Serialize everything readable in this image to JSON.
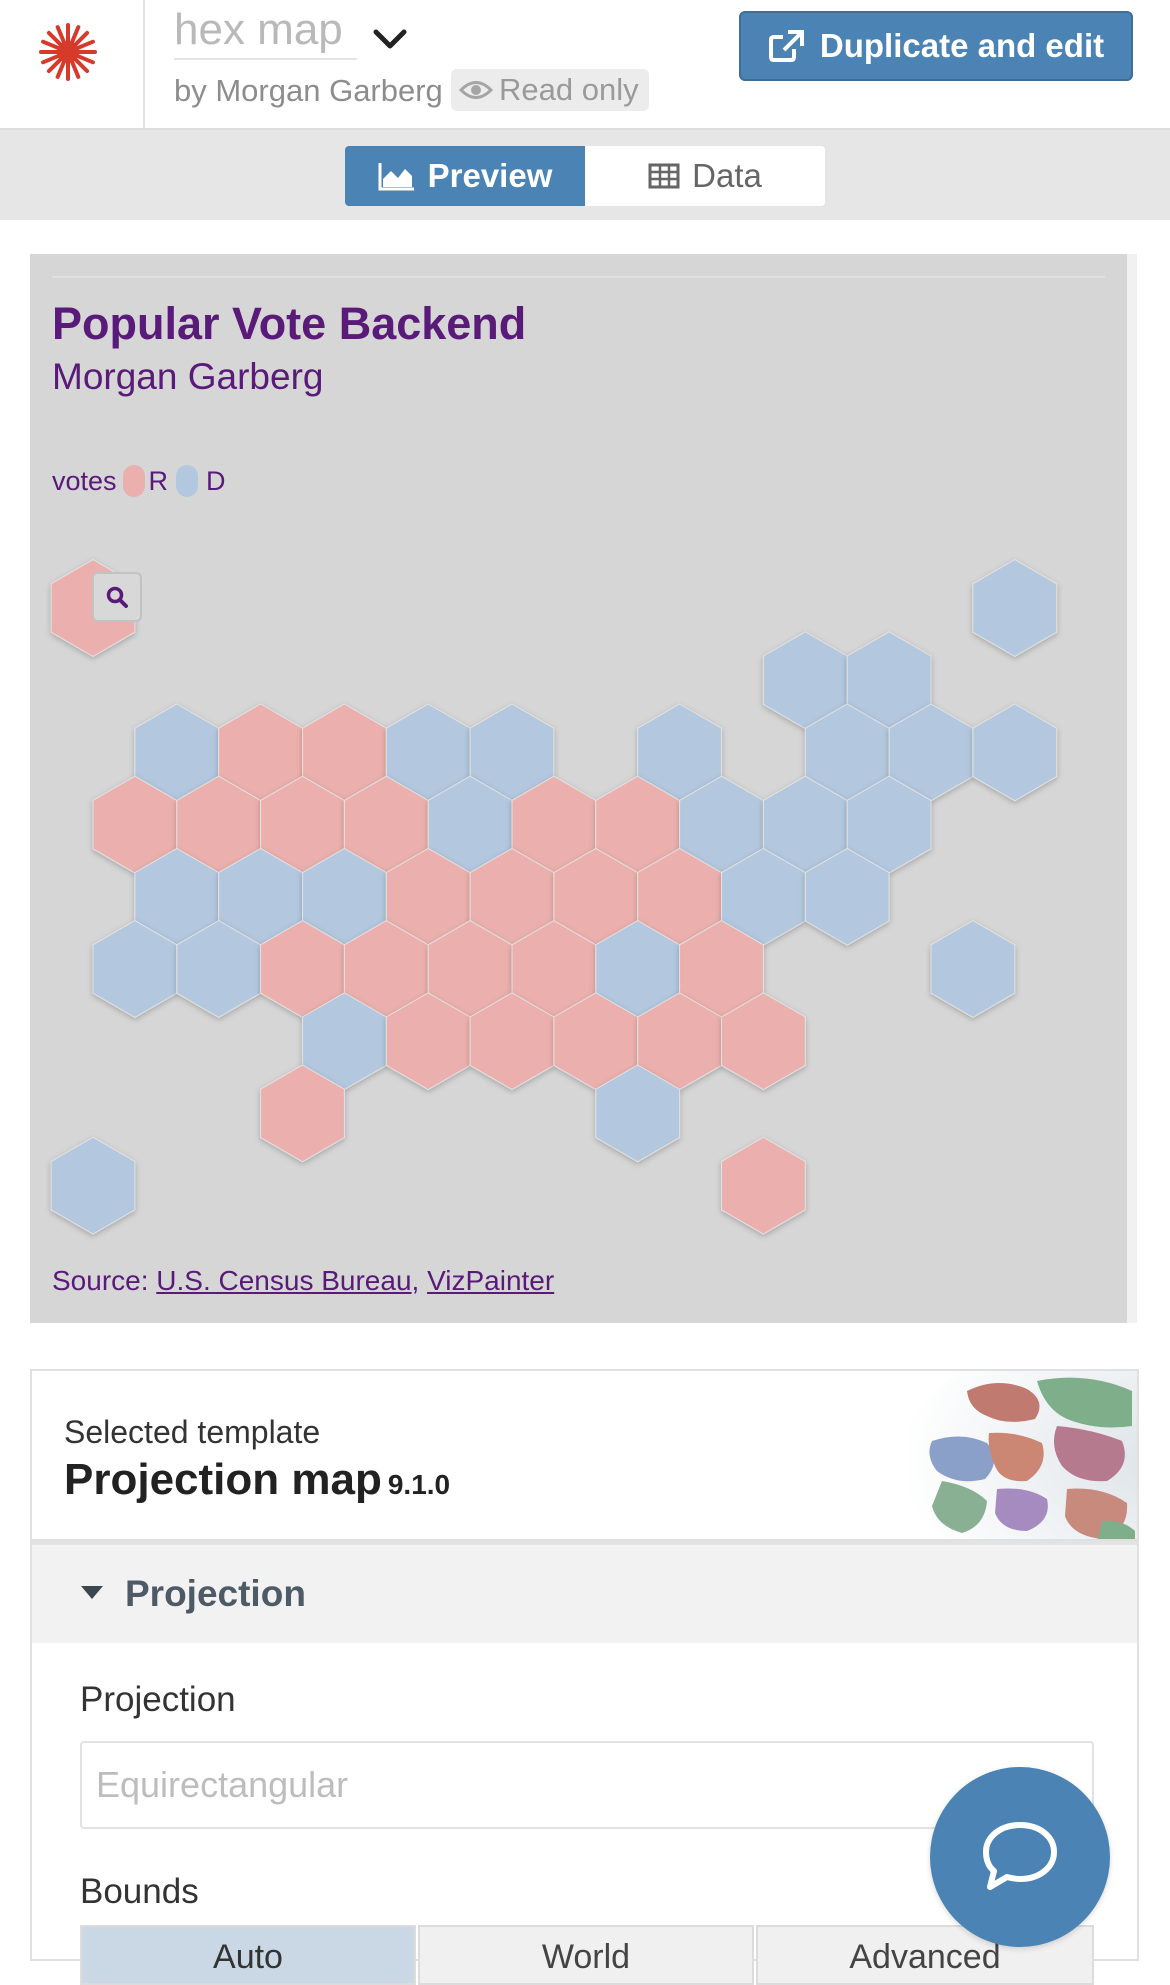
{
  "header": {
    "viz_name": "hex map",
    "byline": "by Morgan Garberg",
    "read_only_label": "Read only",
    "duplicate_label": "Duplicate and edit"
  },
  "tabs": [
    {
      "label": "Preview",
      "active": true
    },
    {
      "label": "Data",
      "active": false
    }
  ],
  "visualization": {
    "title": "Popular Vote Backend",
    "subtitle": "Morgan Garberg",
    "legend": {
      "title": "votes",
      "items": [
        {
          "label": "R",
          "color": "#ebb0ad"
        },
        {
          "label": "D",
          "color": "#b3c7de"
        }
      ]
    },
    "source_prefix": "Source:",
    "source_links": [
      "U.S. Census Bureau",
      "VizPainter"
    ],
    "source_separator": ","
  },
  "hex_states": [
    {
      "row": 0,
      "col": 0,
      "party": "R"
    },
    {
      "row": 0,
      "col": 11,
      "party": "D"
    },
    {
      "row": 1,
      "col": 9,
      "party": "D"
    },
    {
      "row": 1,
      "col": 10,
      "party": "D"
    },
    {
      "row": 2,
      "col": 1,
      "party": "D"
    },
    {
      "row": 2,
      "col": 2,
      "party": "R"
    },
    {
      "row": 2,
      "col": 3,
      "party": "R"
    },
    {
      "row": 2,
      "col": 4,
      "party": "D"
    },
    {
      "row": 2,
      "col": 5,
      "party": "D"
    },
    {
      "row": 2,
      "col": 7,
      "party": "D"
    },
    {
      "row": 2,
      "col": 9,
      "party": "D"
    },
    {
      "row": 2,
      "col": 10,
      "party": "D"
    },
    {
      "row": 2,
      "col": 11,
      "party": "D"
    },
    {
      "row": 3,
      "col": 1,
      "party": "R"
    },
    {
      "row": 3,
      "col": 2,
      "party": "R"
    },
    {
      "row": 3,
      "col": 3,
      "party": "R"
    },
    {
      "row": 3,
      "col": 4,
      "party": "R"
    },
    {
      "row": 3,
      "col": 5,
      "party": "D"
    },
    {
      "row": 3,
      "col": 6,
      "party": "R"
    },
    {
      "row": 3,
      "col": 7,
      "party": "R"
    },
    {
      "row": 3,
      "col": 8,
      "party": "D"
    },
    {
      "row": 3,
      "col": 9,
      "party": "D"
    },
    {
      "row": 3,
      "col": 10,
      "party": "D"
    },
    {
      "row": 4,
      "col": 1,
      "party": "D"
    },
    {
      "row": 4,
      "col": 2,
      "party": "D"
    },
    {
      "row": 4,
      "col": 3,
      "party": "D"
    },
    {
      "row": 4,
      "col": 4,
      "party": "R"
    },
    {
      "row": 4,
      "col": 5,
      "party": "R"
    },
    {
      "row": 4,
      "col": 6,
      "party": "R"
    },
    {
      "row": 4,
      "col": 7,
      "party": "R"
    },
    {
      "row": 4,
      "col": 8,
      "party": "D"
    },
    {
      "row": 4,
      "col": 9,
      "party": "D"
    },
    {
      "row": 5,
      "col": 1,
      "party": "D"
    },
    {
      "row": 5,
      "col": 2,
      "party": "D"
    },
    {
      "row": 5,
      "col": 3,
      "party": "R"
    },
    {
      "row": 5,
      "col": 4,
      "party": "R"
    },
    {
      "row": 5,
      "col": 5,
      "party": "R"
    },
    {
      "row": 5,
      "col": 6,
      "party": "R"
    },
    {
      "row": 5,
      "col": 7,
      "party": "D"
    },
    {
      "row": 5,
      "col": 8,
      "party": "R"
    },
    {
      "row": 5,
      "col": 11,
      "party": "D"
    },
    {
      "row": 6,
      "col": 3,
      "party": "D"
    },
    {
      "row": 6,
      "col": 4,
      "party": "R"
    },
    {
      "row": 6,
      "col": 5,
      "party": "R"
    },
    {
      "row": 6,
      "col": 6,
      "party": "R"
    },
    {
      "row": 6,
      "col": 7,
      "party": "R"
    },
    {
      "row": 6,
      "col": 8,
      "party": "R"
    },
    {
      "row": 7,
      "col": 3,
      "party": "R"
    },
    {
      "row": 7,
      "col": 7,
      "party": "D"
    },
    {
      "row": 8,
      "col": 0,
      "party": "D"
    },
    {
      "row": 8,
      "col": 8,
      "party": "R"
    }
  ],
  "template": {
    "label": "Selected template",
    "name": "Projection map",
    "version": "9.1.0"
  },
  "panel": {
    "title": "Projection",
    "projection_label": "Projection",
    "projection_placeholder": "Equirectangular",
    "bounds_label": "Bounds",
    "bounds_options": [
      "Auto",
      "World",
      "Advanced"
    ],
    "bounds_selected": "Auto"
  },
  "colors": {
    "accent": "#4a83b4",
    "title_purple": "#5a1a7a",
    "republican": "#ebb0ad",
    "democrat": "#b3c7de",
    "map_background": "#d6d6d6"
  },
  "icons": [
    "flourish-logo-icon",
    "chevron-down-icon",
    "eye-icon",
    "external-link-icon",
    "area-chart-icon",
    "table-icon",
    "search-icon",
    "caret-down-icon",
    "chat-icon",
    "world-map-thumbnail"
  ]
}
